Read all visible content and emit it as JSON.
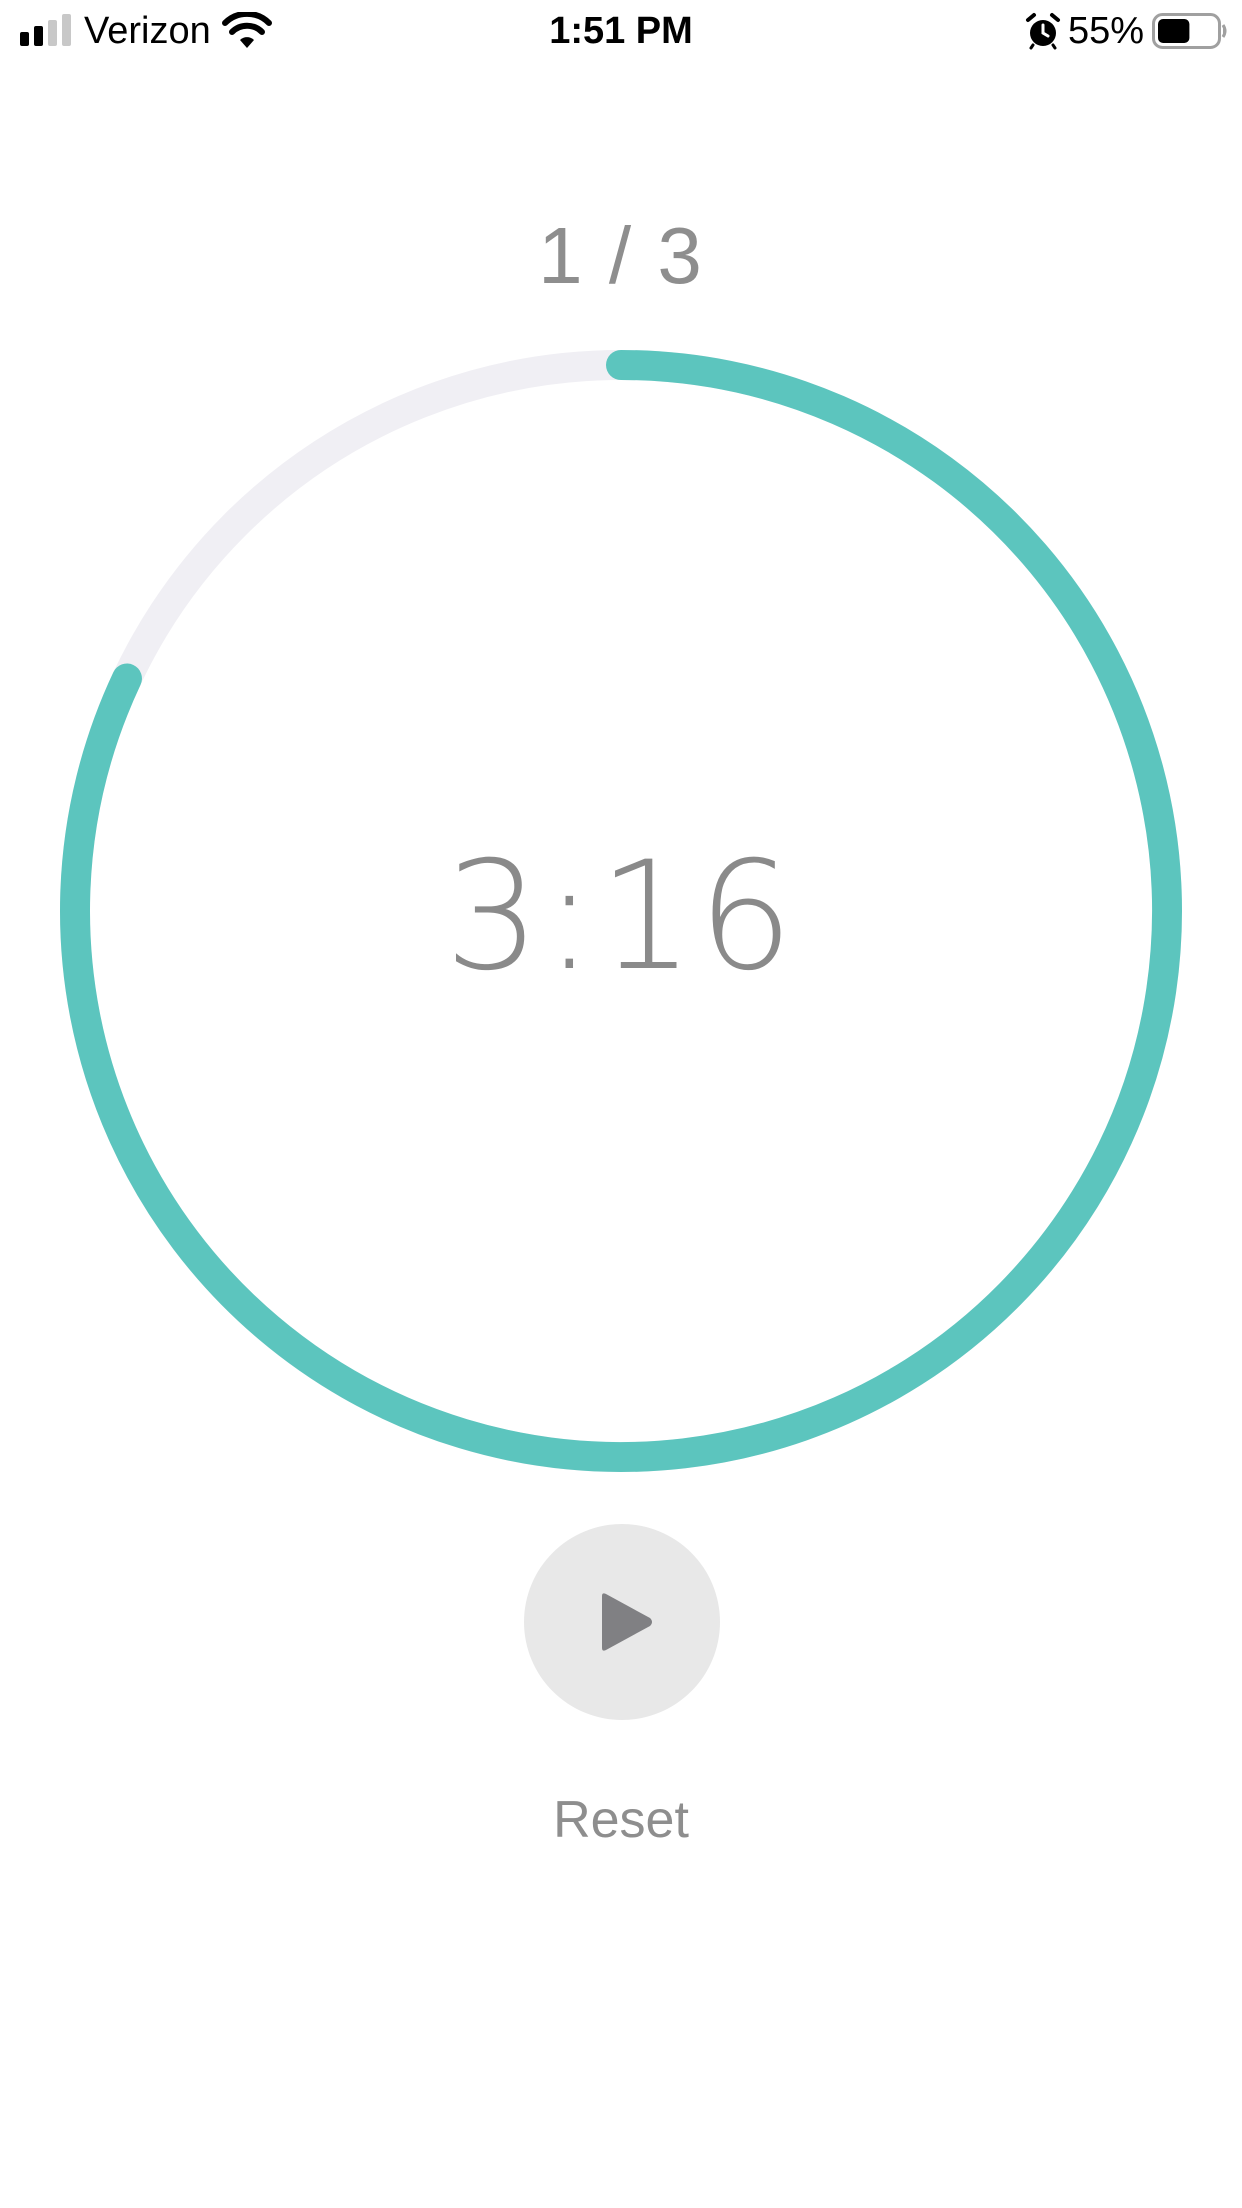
{
  "status_bar": {
    "carrier": "Verizon",
    "time": "1:51 PM",
    "battery_percent": "55%",
    "signal_icon": "signal-bars-icon",
    "wifi_icon": "wifi-icon",
    "alarm_icon": "alarm-clock-icon",
    "battery_icon": "battery-icon",
    "battery_level": 0.55
  },
  "timer": {
    "round_label": "1 / 3",
    "time_remaining": "3:16",
    "progress_fraction": 0.82,
    "progress_color": "#5cc5be",
    "track_color": "#f0eff4"
  },
  "controls": {
    "play_icon": "play-icon",
    "reset_label": "Reset"
  }
}
